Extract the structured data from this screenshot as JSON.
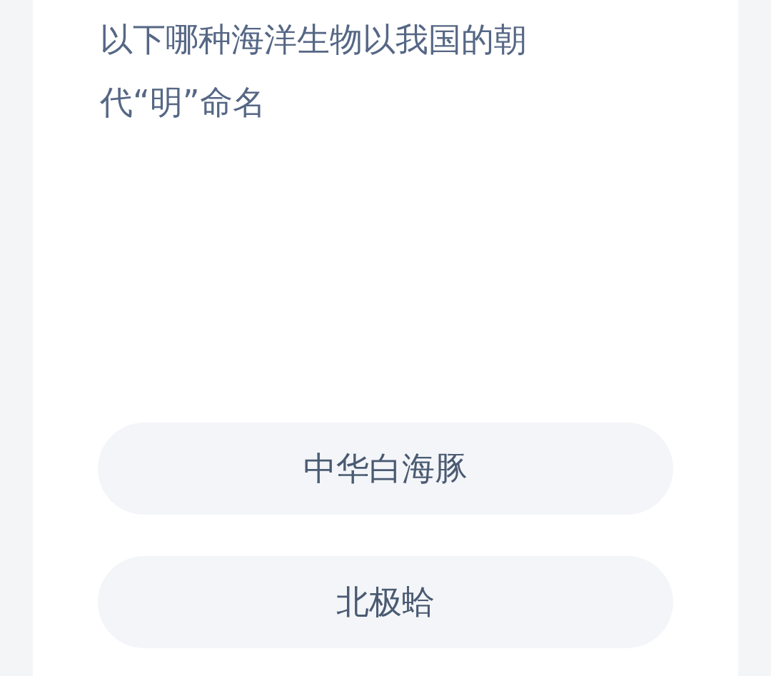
{
  "question": "以下哪种海洋生物以我国的朝代“明”命名",
  "options": [
    {
      "label": "中华白海豚"
    },
    {
      "label": "北极蛤"
    }
  ]
}
